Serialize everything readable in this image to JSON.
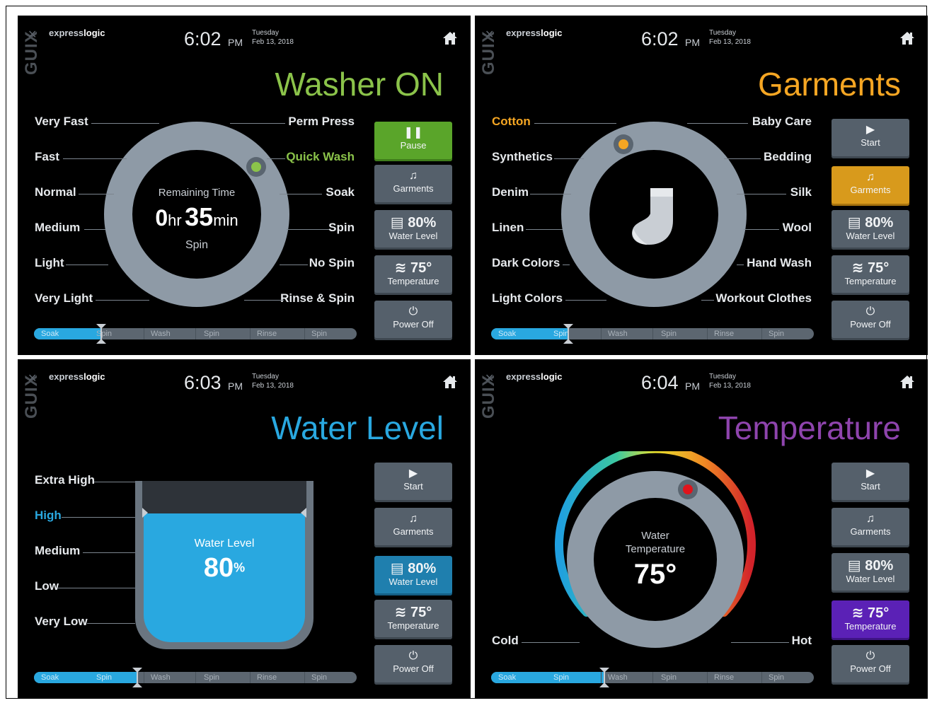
{
  "common": {
    "brand_prefix": "express",
    "brand_suffix": "logic",
    "logo": "GUIX",
    "day": "Tuesday",
    "date": "Feb 13, 2018",
    "ampm": "PM",
    "progress_stages": [
      "Soak",
      "Spin",
      "Wash",
      "Spin",
      "Rinse",
      "Spin"
    ],
    "icons": [
      "home-icon",
      "pause-icon",
      "play-icon",
      "music-note-icon",
      "water-level-icon",
      "heat-icon",
      "power-icon",
      "sock-icon"
    ]
  },
  "panels": [
    {
      "time": "6:02",
      "title": "Washer ON",
      "title_color": "#8bc34a",
      "left_labels": [
        "Very Fast",
        "Fast",
        "Normal",
        "Medium",
        "Light",
        "Very Light"
      ],
      "right_labels": [
        "Perm Press",
        "Quick Wash",
        "Soak",
        "Spin",
        "No Spin",
        "Rinse & Spin"
      ],
      "selected_label": "Quick Wash",
      "selected_color": "#8bc34a",
      "center_title": "Remaining Time",
      "hours": "0",
      "hours_unit": "hr",
      "minutes": "35",
      "minutes_unit": "min",
      "phase": "Spin",
      "buttons": [
        {
          "icon": "pause-icon",
          "label": "Pause",
          "active": true,
          "color": "#5aa52a"
        },
        {
          "icon": "music-note-icon",
          "label": "Garments"
        },
        {
          "icon": "water-level-icon",
          "value": "80%",
          "label": "Water Level"
        },
        {
          "icon": "heat-icon",
          "value": "75°",
          "label": "Temperature"
        },
        {
          "icon": "power-icon",
          "label": "Power Off"
        }
      ],
      "progress": 0.21
    },
    {
      "time": "6:02",
      "title": "Garments",
      "title_color": "#f5a623",
      "left_labels": [
        "Cotton",
        "Synthetics",
        "Denim",
        "Linen",
        "Dark Colors",
        "Light Colors"
      ],
      "right_labels": [
        "Baby Care",
        "Bedding",
        "Silk",
        "Wool",
        "Hand Wash",
        "Workout Clothes"
      ],
      "selected_label": "Cotton",
      "selected_color": "#f5a623",
      "buttons": [
        {
          "icon": "play-icon",
          "label": "Start"
        },
        {
          "icon": "music-note-icon",
          "label": "Garments",
          "active": true,
          "color": "#d89a1c"
        },
        {
          "icon": "water-level-icon",
          "value": "80%",
          "label": "Water Level"
        },
        {
          "icon": "heat-icon",
          "value": "75°",
          "label": "Temperature"
        },
        {
          "icon": "power-icon",
          "label": "Power Off"
        }
      ],
      "progress": 0.24
    },
    {
      "time": "6:03",
      "title": "Water Level",
      "title_color": "#29a8e0",
      "left_labels": [
        "Extra High",
        "High",
        "Medium",
        "Low",
        "Very Low"
      ],
      "selected_label": "High",
      "selected_color": "#29a8e0",
      "center_title": "Water Level",
      "level": "80",
      "level_unit": "%",
      "buttons": [
        {
          "icon": "play-icon",
          "label": "Start"
        },
        {
          "icon": "music-note-icon",
          "label": "Garments"
        },
        {
          "icon": "water-level-icon",
          "value": "80%",
          "label": "Water Level",
          "active": true,
          "color": "#1f7fae"
        },
        {
          "icon": "heat-icon",
          "value": "75°",
          "label": "Temperature"
        },
        {
          "icon": "power-icon",
          "label": "Power Off"
        }
      ],
      "progress": 0.32
    },
    {
      "time": "6:04",
      "title": "Temperature",
      "title_color": "#8e44ad",
      "cold_label": "Cold",
      "hot_label": "Hot",
      "center_title": "Water Temperature",
      "temp": "75°",
      "buttons": [
        {
          "icon": "play-icon",
          "label": "Start"
        },
        {
          "icon": "music-note-icon",
          "label": "Garments"
        },
        {
          "icon": "water-level-icon",
          "value": "80%",
          "label": "Water Level"
        },
        {
          "icon": "heat-icon",
          "value": "75°",
          "label": "Temperature",
          "active": true,
          "color": "#5b21b6"
        },
        {
          "icon": "power-icon",
          "label": "Power Off"
        }
      ],
      "progress": 0.35
    }
  ]
}
